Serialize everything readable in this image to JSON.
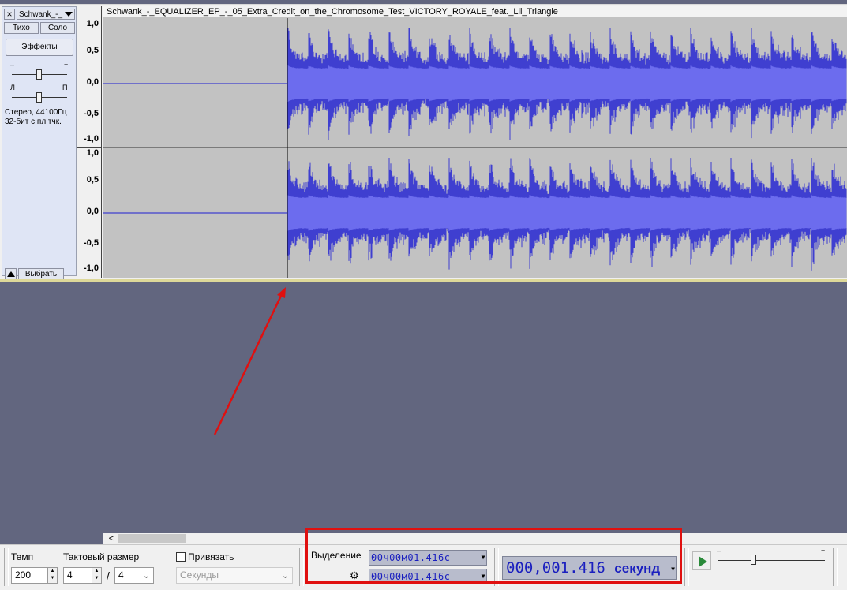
{
  "track": {
    "close_label": "×",
    "name": "Schwank_-_",
    "mute_label": "Тихо",
    "solo_label": "Соло",
    "effects_label": "Эффекты",
    "gain_minus": "–",
    "gain_plus": "+",
    "pan_left": "Л",
    "pan_right": "П",
    "format_line1": "Стерео, 44100Гц",
    "format_line2": "32-бит с пл.тчк.",
    "select_label": "Выбрать",
    "clip_title": "Schwank_-_EQUALIZER_EP_-_05_Extra_Credit_on_the_Chromosome_Test_VICTORY_ROYALE_feat._Lil_Triangle",
    "scale_labels": [
      "1,0",
      "0,5",
      "0,0",
      "-0,5",
      "-1,0"
    ],
    "waveform_color": "#3f3fd0",
    "waveform_rms_color": "#6c6cee",
    "background_color": "#c2c2c2"
  },
  "toolbar": {
    "tempo_label": "Темп",
    "tempo_value": "200",
    "timesig_label": "Тактовый размер",
    "timesig_num": "4",
    "timesig_sep": "/",
    "timesig_den": "4",
    "snap_label": "Привязать",
    "snap_checked": false,
    "snap_unit": "Секунды",
    "selection_label": "Выделение",
    "selection_start": "00ч00м01.416с",
    "selection_end": "00ч00м01.416с",
    "audio_position": "000,001.416",
    "audio_position_unit": "секунд",
    "volume_minus": "–",
    "volume_plus": "+"
  },
  "annotations": {
    "arrow_color": "#e01010",
    "highlight_color": "#e01010"
  }
}
